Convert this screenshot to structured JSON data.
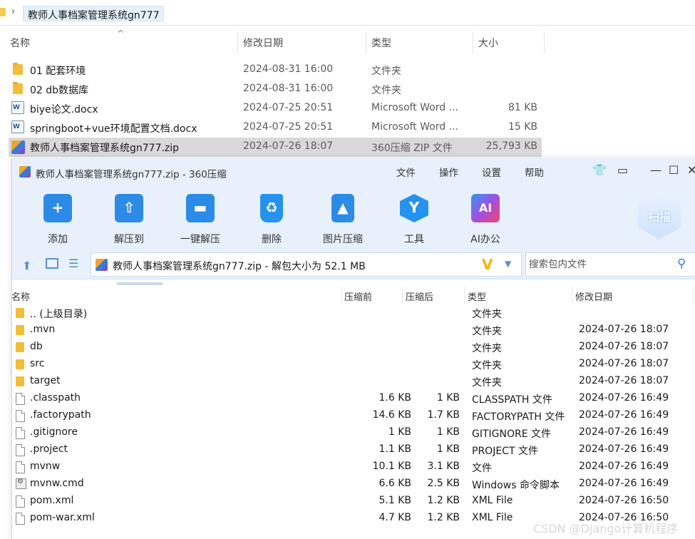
{
  "explorer": {
    "breadcrumb": "教师人事档案管理系统gn777",
    "columns": {
      "name": "名称",
      "date": "修改日期",
      "type": "类型",
      "size": "大小"
    },
    "rows": [
      {
        "name": "01 配套环境",
        "date": "2024-08-31 16:00",
        "type": "文件夹",
        "size": "",
        "icon": "folder-icon"
      },
      {
        "name": "02 db数据库",
        "date": "2024-08-31 16:00",
        "type": "文件夹",
        "size": "",
        "icon": "folder-icon"
      },
      {
        "name": "biye论文.docx",
        "date": "2024-07-25 20:51",
        "type": "Microsoft Word ...",
        "size": "81 KB",
        "icon": "word-doc-icon"
      },
      {
        "name": "springboot+vue环境配置文档.docx",
        "date": "2024-07-25 20:51",
        "type": "Microsoft Word ...",
        "size": "15 KB",
        "icon": "word-doc-icon"
      },
      {
        "name": "教师人事档案管理系统gn777.zip",
        "date": "2024-07-26 18:07",
        "type": "360压缩 ZIP 文件",
        "size": "25,793 KB",
        "icon": "zip-archive-icon",
        "selected": true
      }
    ]
  },
  "archiver": {
    "title": "教师人事档案管理系统gn777.zip - 360压缩",
    "menu": [
      "文件",
      "操作",
      "设置",
      "帮助"
    ],
    "tools": [
      {
        "label": "添加",
        "icon": "add-icon"
      },
      {
        "label": "解压到",
        "icon": "extract-to-icon"
      },
      {
        "label": "一键解压",
        "icon": "one-click-extract-icon"
      },
      {
        "label": "删除",
        "icon": "delete-icon"
      },
      {
        "label": "图片压缩",
        "icon": "image-compress-icon"
      },
      {
        "label": "工具",
        "icon": "tools-icon"
      },
      {
        "label": "AI办公",
        "icon": "ai-office-icon",
        "glyph": "AI"
      }
    ],
    "scan_label": "扫描",
    "path": "教师人事档案管理系统gn777.zip - 解包大小为 52.1 MB",
    "search_placeholder": "搜索包内文件",
    "columns": {
      "name": "名称",
      "compressed": "压缩前",
      "uncompressed": "压缩后",
      "type": "类型",
      "date": "修改日期"
    },
    "items": [
      {
        "name": ".. (上级目录)",
        "before": "",
        "after": "",
        "type": "文件夹",
        "date": "",
        "icon": "folder-icon"
      },
      {
        "name": ".mvn",
        "before": "",
        "after": "",
        "type": "文件夹",
        "date": "2024-07-26 18:07",
        "icon": "folder-icon"
      },
      {
        "name": "db",
        "before": "",
        "after": "",
        "type": "文件夹",
        "date": "2024-07-26 18:07",
        "icon": "folder-icon"
      },
      {
        "name": "src",
        "before": "",
        "after": "",
        "type": "文件夹",
        "date": "2024-07-26 18:07",
        "icon": "folder-icon"
      },
      {
        "name": "target",
        "before": "",
        "after": "",
        "type": "文件夹",
        "date": "2024-07-26 18:07",
        "icon": "folder-icon"
      },
      {
        "name": ".classpath",
        "before": "1.6 KB",
        "after": "1 KB",
        "type": "CLASSPATH 文件",
        "date": "2024-07-26 16:49",
        "icon": "file-icon"
      },
      {
        "name": ".factorypath",
        "before": "14.6 KB",
        "after": "1.7 KB",
        "type": "FACTORYPATH 文件",
        "date": "2024-07-26 16:49",
        "icon": "file-icon"
      },
      {
        "name": ".gitignore",
        "before": "1 KB",
        "after": "1 KB",
        "type": "GITIGNORE 文件",
        "date": "2024-07-26 16:49",
        "icon": "file-icon"
      },
      {
        "name": ".project",
        "before": "1.1 KB",
        "after": "1 KB",
        "type": "PROJECT 文件",
        "date": "2024-07-26 16:49",
        "icon": "file-icon"
      },
      {
        "name": "mvnw",
        "before": "10.1 KB",
        "after": "3.1 KB",
        "type": "文件",
        "date": "2024-07-26 16:49",
        "icon": "file-icon"
      },
      {
        "name": "mvnw.cmd",
        "before": "6.6 KB",
        "after": "2.5 KB",
        "type": "Windows 命令脚本",
        "date": "2024-07-26 16:49",
        "icon": "cmd-script-icon"
      },
      {
        "name": "pom.xml",
        "before": "5.1 KB",
        "after": "1.2 KB",
        "type": "XML File",
        "date": "2024-07-26 16:50",
        "icon": "file-icon"
      },
      {
        "name": "pom-war.xml",
        "before": "4.7 KB",
        "after": "1.2 KB",
        "type": "XML File",
        "date": "2024-07-26 16:50",
        "icon": "file-icon"
      }
    ]
  },
  "watermark": "CSDN @Django计算机程序"
}
